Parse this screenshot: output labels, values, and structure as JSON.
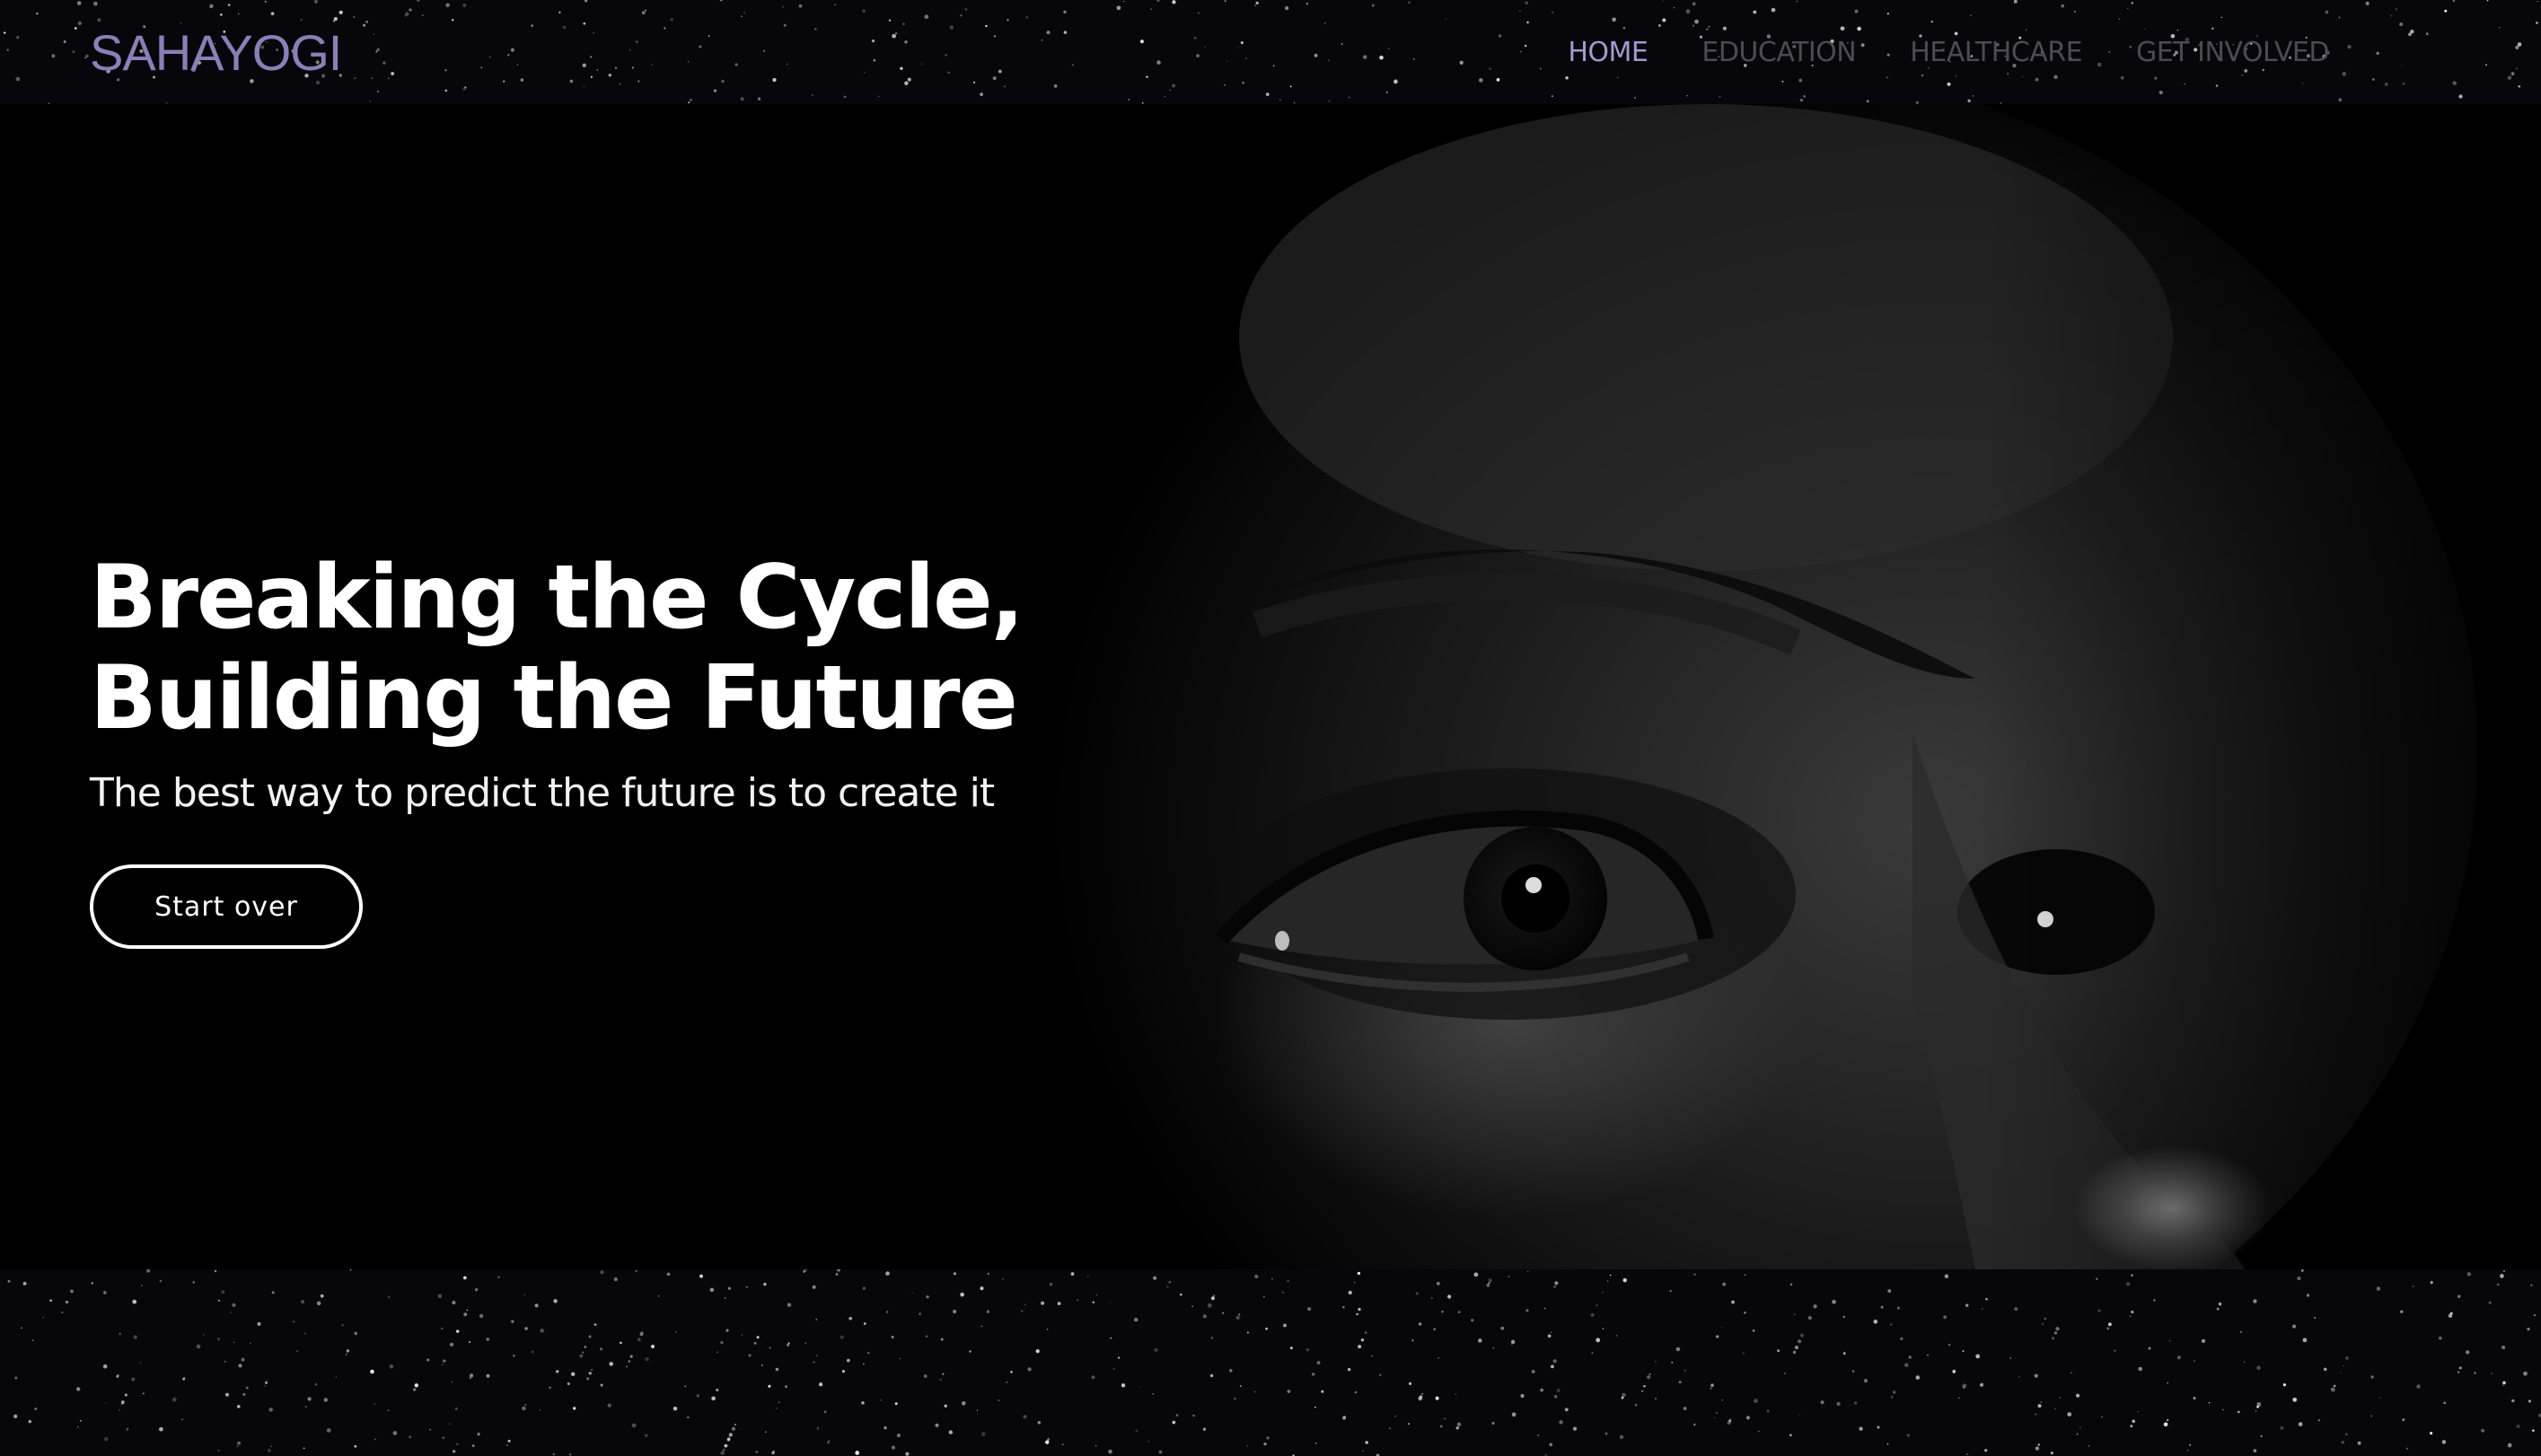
{
  "header": {
    "brand": "SAHAYOGI",
    "nav": [
      {
        "label": "HOME",
        "active": true
      },
      {
        "label": "EDUCATION",
        "active": false
      },
      {
        "label": "HEALTHCARE",
        "active": false
      },
      {
        "label": "GET INVOLVED",
        "active": false
      }
    ]
  },
  "hero": {
    "title_line1": "Breaking the Cycle,",
    "title_line2": "Building the Future",
    "subtitle": "The best way to predict the future is to create it",
    "button_label": "Start over"
  },
  "colors": {
    "background": "#07060b",
    "brand": "#8c7fb8",
    "nav_active": "#a49ad0",
    "nav_inactive": "#4d4a55",
    "hero_text": "#ffffff"
  }
}
